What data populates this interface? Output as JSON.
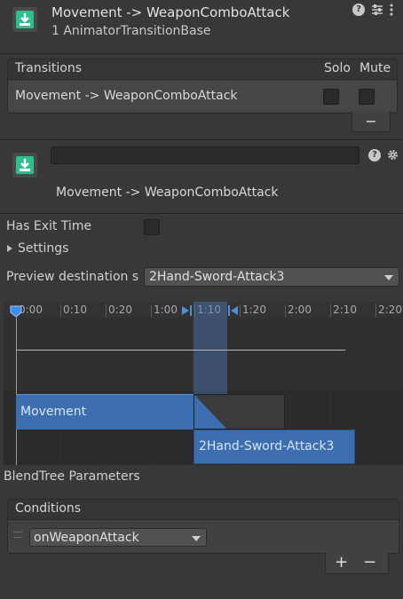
{
  "header": {
    "title": "Movement -> WeaponComboAttack",
    "subtitle": "1 AnimatorTransitionBase"
  },
  "transitions": {
    "header": "Transitions",
    "col_solo": "Solo",
    "col_mute": "Mute",
    "rows": [
      {
        "label": "Movement -> WeaponComboAttack",
        "solo": false,
        "mute": false
      }
    ],
    "remove_label": "−"
  },
  "transition": {
    "name_value": "",
    "subtitle": "Movement -> WeaponComboAttack"
  },
  "settings": {
    "has_exit_time_label": "Has Exit Time",
    "has_exit_time": false,
    "settings_label": "Settings",
    "preview_label": "Preview destination s",
    "preview_value": "2Hand-Sword-Attack3"
  },
  "timeline": {
    "ticks": [
      "0:00",
      "0:10",
      "0:20",
      "1:00",
      "1:10",
      "1:20",
      "2:00",
      "2:10",
      "2:20"
    ],
    "source_state": "Movement",
    "dest_state": "2Hand-Sword-Attack3",
    "accent": "#3d6fb0"
  },
  "blendtree": {
    "label": "BlendTree Parameters"
  },
  "conditions": {
    "header": "Conditions",
    "items": [
      {
        "parameter": "onWeaponAttack"
      }
    ],
    "add_label": "+",
    "remove_label": "−"
  }
}
